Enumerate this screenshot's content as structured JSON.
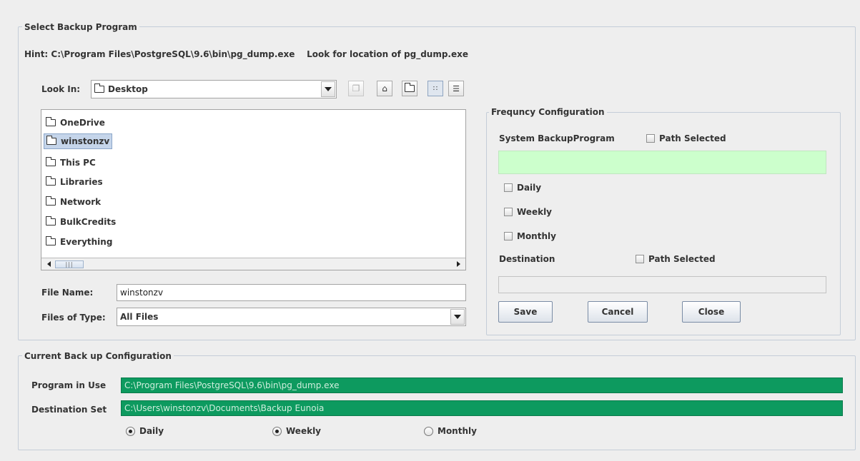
{
  "select_panel": {
    "title": "Select Backup Program",
    "hint": "Hint: C:\\Program Files\\PostgreSQL\\9.6\\bin\\pg_dump.exe    Look for location of pg_dump.exe",
    "look_in_label": "Look In:",
    "look_in_value": "Desktop",
    "folders": [
      "OneDrive",
      "winstonzv",
      "This PC",
      "Libraries",
      "Network",
      "BulkCredits",
      "Everything"
    ],
    "selected_folder": "winstonzv",
    "file_name_label": "File Name:",
    "file_name_value": "winstonzv",
    "files_of_type_label": "Files of Type:",
    "files_of_type_value": "All Files",
    "scroll_thumb": "|||"
  },
  "frequency_panel": {
    "title": "Frequncy Configuration",
    "system_program_label": "System BackupProgram",
    "path_selected_label": "Path Selected",
    "daily_label": "Daily",
    "weekly_label": "Weekly",
    "monthly_label": "Monthly",
    "destination_label": "Destination",
    "dest_path_selected_label": "Path Selected",
    "save_label": "Save",
    "cancel_label": "Cancel",
    "close_label": "Close"
  },
  "current_panel": {
    "title": "Current Back up Configuration",
    "program_label": "Program in Use",
    "program_value": "C:\\Program Files\\PostgreSQL\\9.6\\bin\\pg_dump.exe",
    "destination_label": "Destination Set",
    "destination_value": "C:\\Users\\winstonzv\\Documents\\Backup Eunoia",
    "daily_label": "Daily",
    "weekly_label": "Weekly",
    "monthly_label": "Monthly"
  },
  "colors": {
    "panel_background": "#eeeeee",
    "border": "#c4cdd8",
    "path_ok_green": "#ccffcc",
    "config_green": "#0d9a5f",
    "selection_blue": "#c5d5ea"
  }
}
